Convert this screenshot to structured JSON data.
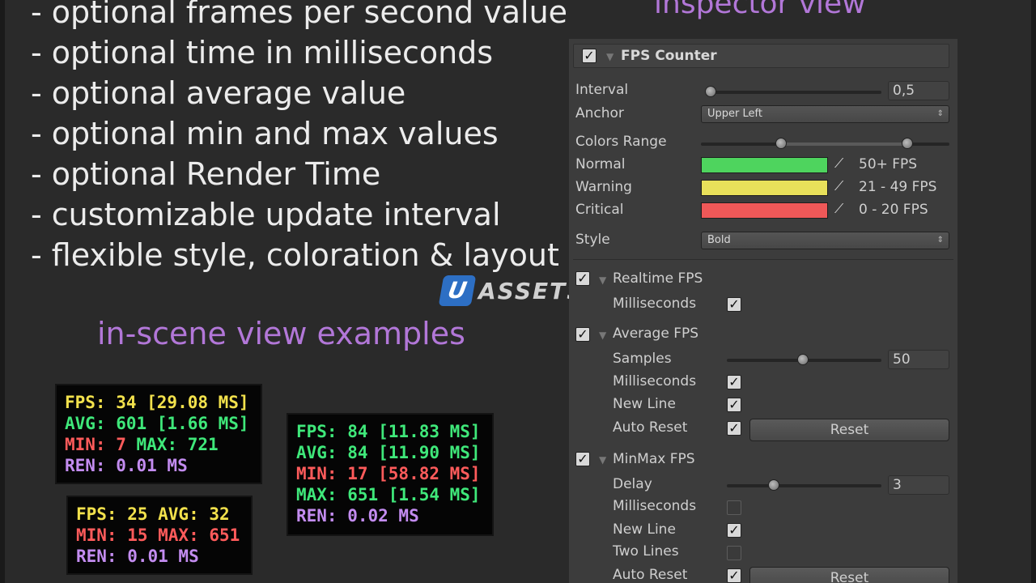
{
  "features": [
    "- optional frames per second value",
    "- optional time in milliseconds",
    "- optional average value",
    "- optional min and max values",
    "- optional Render Time",
    "- customizable update interval",
    "- flexible style, coloration & layout"
  ],
  "inspector_title": "inspector view",
  "scene_title": "in-scene view examples",
  "watermark": {
    "badge": "U",
    "text": "ASSETS"
  },
  "colors": {
    "accent_purple": "#b277d8",
    "fps_yellow": "#f2e14c",
    "fps_green": "#3fe87a",
    "fps_red": "#ff5b5b",
    "fps_purple": "#c38cf0"
  },
  "fps_boxes": [
    {
      "rows": [
        [
          {
            "text": "FPS: 34 [29.08 MS]",
            "color": "yellow"
          }
        ],
        [
          {
            "text": "AVG: 601 [1.66 MS]",
            "color": "green"
          }
        ],
        [
          {
            "text": "MIN: 7 ",
            "color": "red"
          },
          {
            "text": "MAX: 721",
            "color": "green"
          }
        ],
        [
          {
            "text": "REN: 0.01 MS",
            "color": "purple"
          }
        ]
      ]
    },
    {
      "rows": [
        [
          {
            "text": "FPS: 25 AVG: 32",
            "color": "yellow"
          }
        ],
        [
          {
            "text": "MIN: 15 MAX: 651",
            "color": "red"
          }
        ],
        [
          {
            "text": "REN: 0.01 MS",
            "color": "purple"
          }
        ]
      ]
    },
    {
      "rows": [
        [
          {
            "text": "FPS: 84 [11.83 MS]",
            "color": "green"
          }
        ],
        [
          {
            "text": "AVG: 84 [11.90 MS]",
            "color": "green"
          }
        ],
        [
          {
            "text": "MIN: 17 [58.82 MS]",
            "color": "red"
          }
        ],
        [
          {
            "text": "MAX: 651 [1.54 MS]",
            "color": "green"
          }
        ],
        [
          {
            "text": "REN: 0.02 MS",
            "color": "purple"
          }
        ]
      ]
    }
  ],
  "inspector": {
    "component_title": "FPS Counter",
    "interval": {
      "label": "Interval",
      "value": "0,5"
    },
    "anchor": {
      "label": "Anchor",
      "value": "Upper Left"
    },
    "colors_range": {
      "label": "Colors Range"
    },
    "normal": {
      "label": "Normal",
      "range": "50+ FPS",
      "color": "#4ed45e"
    },
    "warning": {
      "label": "Warning",
      "range": "21 - 49 FPS",
      "color": "#e8e05a"
    },
    "critical": {
      "label": "Critical",
      "range": "0 - 20 FPS",
      "color": "#f05858"
    },
    "style": {
      "label": "Style",
      "value": "Bold"
    },
    "realtime": {
      "label": "Realtime FPS",
      "milliseconds_label": "Milliseconds"
    },
    "average": {
      "label": "Average FPS",
      "samples_label": "Samples",
      "samples_value": "50",
      "milliseconds_label": "Milliseconds",
      "new_line_label": "New Line",
      "auto_reset_label": "Auto Reset",
      "reset_button": "Reset"
    },
    "minmax": {
      "label": "MinMax FPS",
      "delay_label": "Delay",
      "delay_value": "3",
      "milliseconds_label": "Milliseconds",
      "new_line_label": "New Line",
      "two_lines_label": "Two Lines",
      "auto_reset_label": "Auto Reset",
      "reset_button": "Reset"
    }
  }
}
